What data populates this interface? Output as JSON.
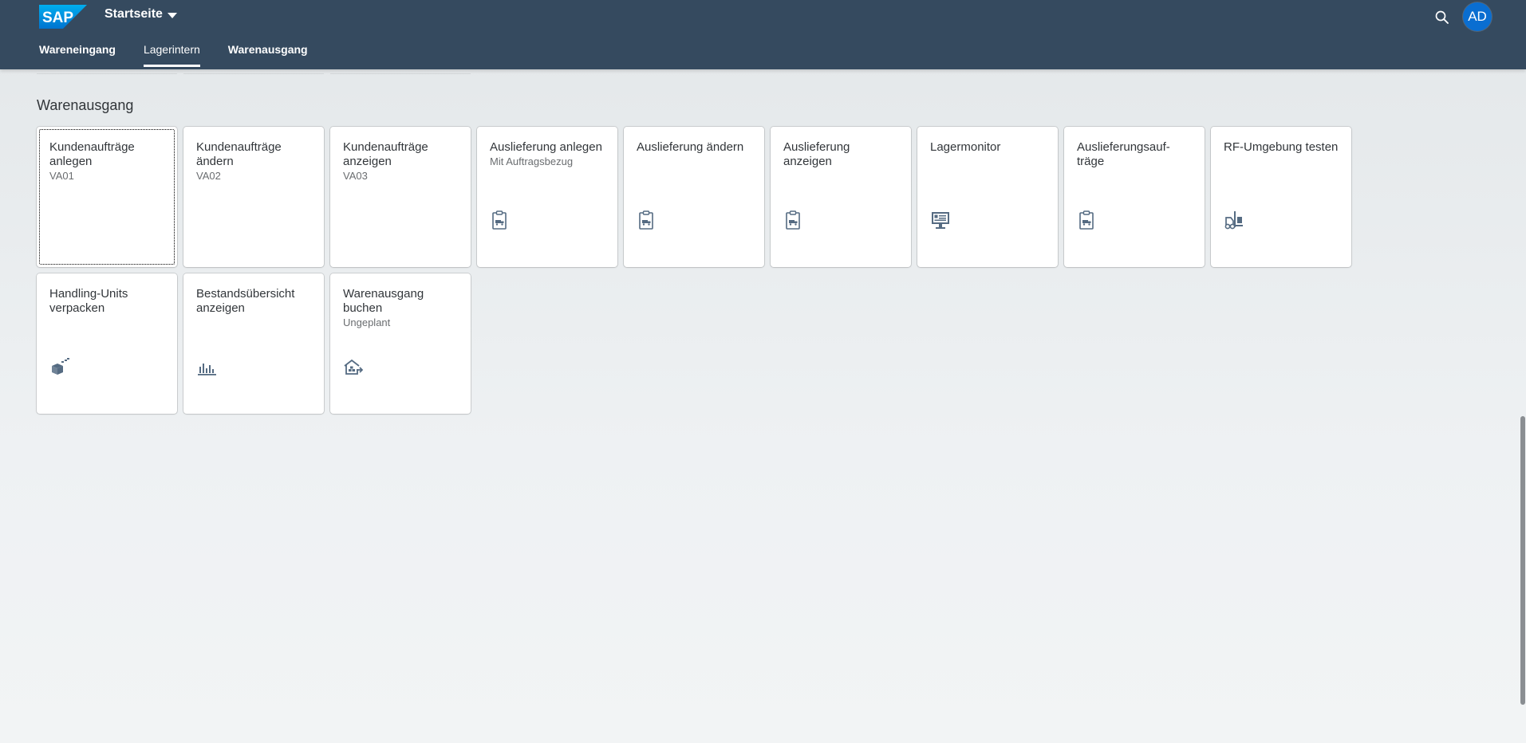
{
  "shell": {
    "logo_text": "SAP",
    "home_title": "Startseite",
    "user_initials": "AD",
    "colors": {
      "header": "#354a5f",
      "accent": "#0a6ed1"
    }
  },
  "tabs": [
    {
      "label": "Wareneingang",
      "active": false
    },
    {
      "label": "Lagerintern",
      "active": true
    },
    {
      "label": "Warenausgang",
      "active": false
    }
  ],
  "section": {
    "title": "Warenausgang",
    "tiles": [
      {
        "title": "Kundenaufträge anlegen",
        "subtitle": "VA01",
        "icon": "none"
      },
      {
        "title": "Kundenaufträge ändern",
        "subtitle": "VA02",
        "icon": "none"
      },
      {
        "title": "Kundenaufträge anzeigen",
        "subtitle": "VA03",
        "icon": "none"
      },
      {
        "title": "Auslieferung anlegen",
        "subtitle": "Mit Auftragsbezug",
        "icon": "clipboard-truck-icon"
      },
      {
        "title": "Auslieferung ändern",
        "subtitle": "",
        "icon": "clipboard-truck-icon"
      },
      {
        "title": "Auslieferung anzeigen",
        "subtitle": "",
        "icon": "clipboard-truck-icon"
      },
      {
        "title": "Lagermonitor",
        "subtitle": "",
        "icon": "monitor-icon"
      },
      {
        "title": "Auslieferungsauf- träge",
        "subtitle": "",
        "icon": "clipboard-truck-icon"
      },
      {
        "title": "RF-Umgebung testen",
        "subtitle": "",
        "icon": "forklift-icon"
      },
      {
        "title": "Handling-Units verpacken",
        "subtitle": "",
        "icon": "package-icon"
      },
      {
        "title": "Bestandsübersicht anzeigen",
        "subtitle": "",
        "icon": "bar-chart-icon"
      },
      {
        "title": "Warenausgang buchen",
        "subtitle": "Ungeplant",
        "icon": "warehouse-exit-icon"
      }
    ]
  }
}
